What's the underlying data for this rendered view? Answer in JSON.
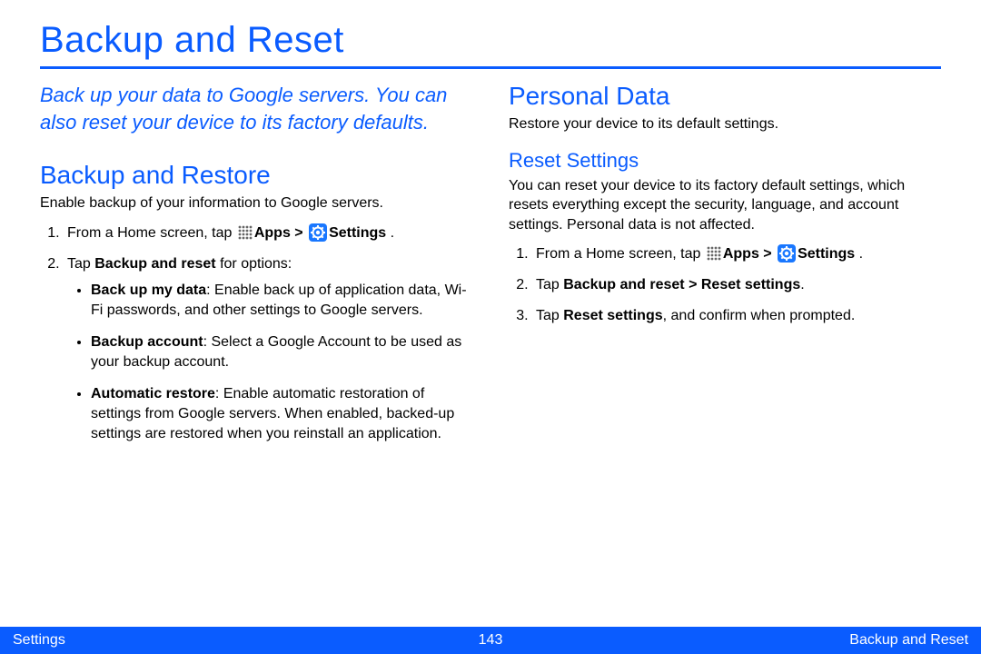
{
  "page": {
    "title": "Backup and Reset"
  },
  "left": {
    "intro": "Back up your data to Google servers. You can also reset your device to its factory defaults.",
    "section": "Backup and Restore",
    "lead": "Enable backup of your information to Google servers.",
    "step1_pre": "From a Home screen, tap ",
    "step1_apps": "Apps",
    "step1_gt": " > ",
    "step1_settings": "Settings",
    "step1_post": " .",
    "step2_pre": "Tap ",
    "step2_bold": "Backup and reset",
    "step2_post": " for options:",
    "bullets": {
      "b1_title": "Back up my data",
      "b1_rest": ": Enable back up of application data, Wi-Fi passwords, and other settings to Google servers.",
      "b2_title": "Backup account",
      "b2_rest": ": Select a Google Account to be used as your backup account.",
      "b3_title": "Automatic restore",
      "b3_rest": ": Enable automatic restoration of settings from Google servers. When enabled, backed-up settings are restored when you reinstall an application."
    }
  },
  "right": {
    "section": "Personal Data",
    "lead": "Restore your device to its default settings.",
    "subsection": "Reset Settings",
    "sublead": "You can reset your device to its factory default settings, which resets everything except the security, language, and account settings. Personal data is not affected.",
    "step1_pre": "From a Home screen, tap ",
    "step1_apps": "Apps",
    "step1_gt": " > ",
    "step1_settings": "Settings",
    "step1_post": " .",
    "step2_pre": "Tap ",
    "step2_bold": "Backup and reset > Reset settings",
    "step2_post": ".",
    "step3_pre": "Tap ",
    "step3_bold": "Reset settings",
    "step3_post": ", and confirm when prompted."
  },
  "footer": {
    "left": "Settings",
    "center": "143",
    "right": "Backup and Reset"
  }
}
